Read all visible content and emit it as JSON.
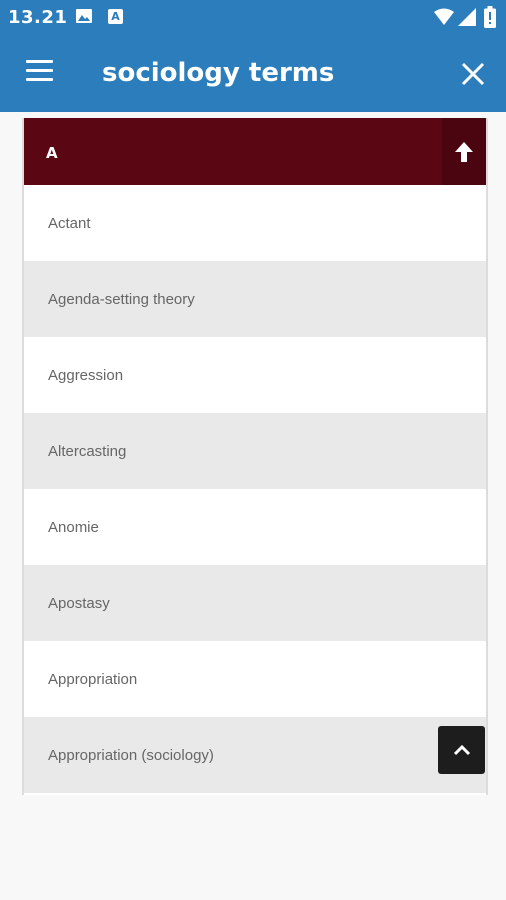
{
  "status_bar": {
    "time": "13.21",
    "notification_letter": "A",
    "icons": [
      "image-icon",
      "a-icon",
      "wifi-icon",
      "signal-icon",
      "battery-icon"
    ]
  },
  "app_bar": {
    "title": "sociology terms",
    "icons": [
      "menu-icon",
      "close-icon"
    ]
  },
  "section": {
    "letter": "A",
    "icon": "arrow-up-icon"
  },
  "terms": [
    "Actant",
    "Agenda-setting theory",
    "Aggression",
    "Altercasting",
    "Anomie",
    "Apostasy",
    "Appropriation",
    "Appropriation (sociology)"
  ],
  "scroll_top_icon": "chevron-up-icon",
  "colors": {
    "app_bar": "#2b7dbb",
    "section_header": "#5b0713",
    "row_alt": "#e9e9e9"
  }
}
